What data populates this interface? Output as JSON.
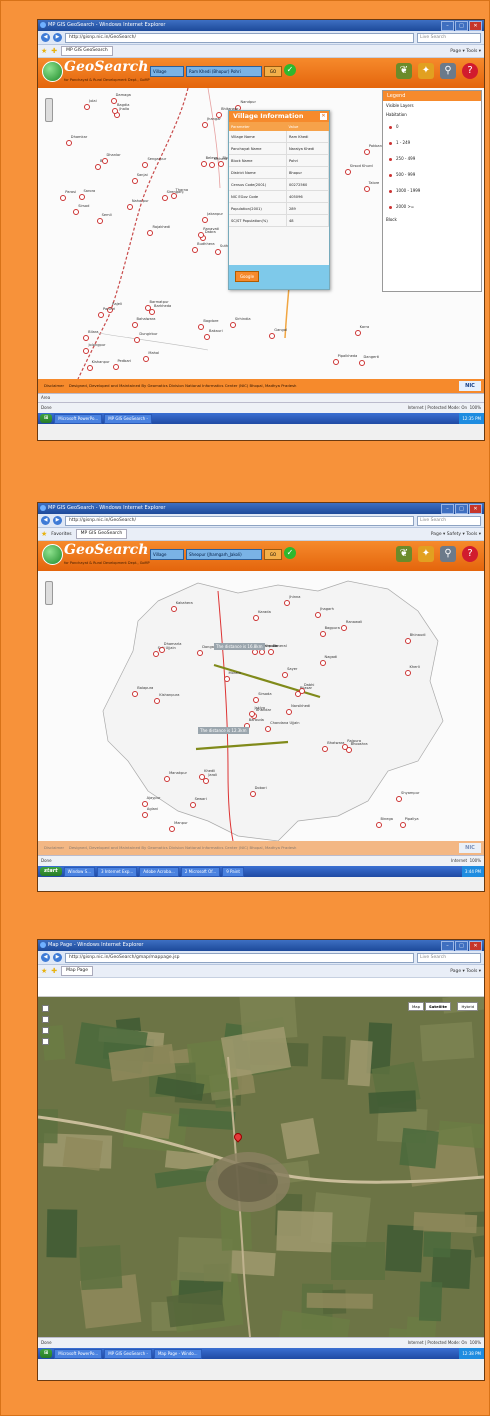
{
  "colors": {
    "background": "#f7923a",
    "accent": "#f68a2c",
    "ie_title": "#1d4a9a"
  },
  "panel1": {
    "title": "MP GIS GeoSearch - Windows Internet Explorer",
    "url": "http://gisnp.nic.in/GeoSearch/",
    "search_placeholder": "Live Search",
    "tab": "MP GIS GeoSearch",
    "tools": "Page ▾  Tools ▾",
    "app_title": "GeoSearch",
    "app_subtitle": "for Panchayat & Rural Development Dept., GoMP",
    "dropdown1": "Village",
    "dropdown2": "Ram Khedi (Bhopur) Pohri",
    "go": "GO",
    "places": [
      "Sutha",
      "Bali",
      "Dabra",
      "Bilara",
      "Barkheda",
      "Bhomrai",
      "Jhalla",
      "Dangerti",
      "Semli",
      "Pokbanta",
      "Budhhera",
      "Pedbari",
      "Beleva",
      "Rajeli",
      "Tharna",
      "Jolongpur",
      "Dungirbur",
      "Richera",
      "Dhanlor",
      "Jhangar",
      "Sirsod",
      "Talore",
      "Ranavati",
      "Bagdore",
      "Jakanpur",
      "Sengarpur",
      "Barmatpur",
      "Pipalkheda",
      "Karra",
      "Nandpur",
      "Sirenganj",
      "Naharpur",
      "Mahal",
      "Parasi",
      "Kishanpur",
      "Bakauri",
      "Panihri",
      "Sirsod Khurd",
      "Dhamkar",
      "Gangal",
      "Bahalwara",
      "Bagdia",
      "Jolai",
      "Sirhindia",
      "Bhitarwar",
      "Rajakhedi",
      "Sarora",
      "Sanjai",
      "Damaga"
    ],
    "popup": {
      "title": "Village Information",
      "col_param": "Parameter",
      "col_value": "Value",
      "rows": [
        {
          "p": "Village Name",
          "v": "Ram Khedi"
        },
        {
          "p": "Panchayat Name",
          "v": "Naraiya Khedi"
        },
        {
          "p": "Block Name",
          "v": "Pohri"
        },
        {
          "p": "District Name",
          "v": "Bhopur"
        },
        {
          "p": "Census Code(2001)",
          "v": "00272560"
        },
        {
          "p": "NIC EGov Code",
          "v": "405096"
        },
        {
          "p": "Population(2001)",
          "v": "289"
        },
        {
          "p": "SC/ST Population(%)",
          "v": "48"
        }
      ],
      "google": "Google"
    },
    "legend": {
      "title": "Legend",
      "visible": "Visible Layers",
      "group": "Habitation",
      "items": [
        "0",
        "1 - 249",
        "250 - 499",
        "500 - 999",
        "1000 - 1999",
        "2000 >="
      ],
      "block": "Block"
    },
    "disclaimer_label": "Disclaimer",
    "disclaimer": "Designed, Developed and Maintained By Geomatics Division National Informatics Center (NIC) Bhopal, Madhya Pradesh",
    "nic": "NIC",
    "bottom_tab": "Area",
    "status_left": "Done",
    "status_mid": "Internet | Protected Mode: On",
    "status_zoom": "100%",
    "taskbar": [
      "Microsoft PowerPo...",
      "MP GIS GeoSearch -"
    ],
    "clock": "12:35 PM"
  },
  "panel2": {
    "title": "MP GIS GeoSearch - Windows Internet Explorer",
    "url": "http://gisnp.nic.in/GeoSearch/",
    "search_placeholder": "Live Search",
    "tab": "MP GIS GeoSearch",
    "tab_label": "Favorites",
    "tools": "Page ▾ Safety ▾ Tools ▾",
    "app_title": "GeoSearch",
    "app_subtitle": "for Panchayat & Rural Development Dept., GoMP",
    "dropdown1": "Village",
    "dropdown2": "Sheopur (Jhamgarh_Jakoli)",
    "go": "GO",
    "measure1": "The distance is 16.8km",
    "measure2": "The distance is 12.3km",
    "places": [
      "Chandana Ujjain",
      "Soti Ujjain",
      "Bhandar",
      "Ajaypur",
      "Bijasar",
      "Jaroli",
      "Jhagarh",
      "Deneral",
      "Bagpura",
      "Narsikhedi",
      "Kakahera",
      "Pipaliya",
      "Kishanpura",
      "Bhinaudi",
      "Barauda",
      "Nagadi",
      "Manpur",
      "Kalyanpura",
      "Sayer",
      "Manakpur",
      "Moram",
      "Aglani",
      "Sewari",
      "Nimoda",
      "Dabhi",
      "Bhooshra",
      "Dhamarla",
      "Karada",
      "Balapura",
      "Bhatwara",
      "Kherli",
      "Jaklya",
      "Dobari",
      "Sirsoda",
      "Dongara",
      "Ranawali",
      "Khedli",
      "Binega",
      "Shyampur",
      "Rajpura",
      "Jhinna"
    ],
    "disclaimer_label": "Disclaimer",
    "disclaimer": "Designed, Developed and Maintained By Geomatics Division National Informatics Center (NIC) Bhopal, Madhya Pradesh",
    "nic": "NIC",
    "status_left": "Done",
    "status_mid": "Internet",
    "status_zoom": "100%",
    "start": "start",
    "taskbar": [
      "Window S...",
      "3 Internet Exp...",
      "Adobe Acroba...",
      "2 Microsoft Of...",
      "9 Paint",
      "Microsoft Power..."
    ],
    "clock": "3:44 PM"
  },
  "panel3": {
    "title": "Map Page - Windows Internet Explorer",
    "url": "http://gisnp.nic.in/GeoSearch/gmap/mappage.jsp",
    "search_placeholder": "Live Search",
    "tab": "Map Page",
    "tools": "Page ▾  Tools ▾",
    "map_types": [
      "Map",
      "Satellite",
      "Hybrid"
    ],
    "status_left": "Done",
    "status_mid": "Internet | Protected Mode: On",
    "status_zoom": "100%",
    "taskbar": [
      "Microsoft PowerPo...",
      "MP GIS GeoSearch -",
      "Map Page - Windo..."
    ],
    "clock": "12:38 PM"
  }
}
